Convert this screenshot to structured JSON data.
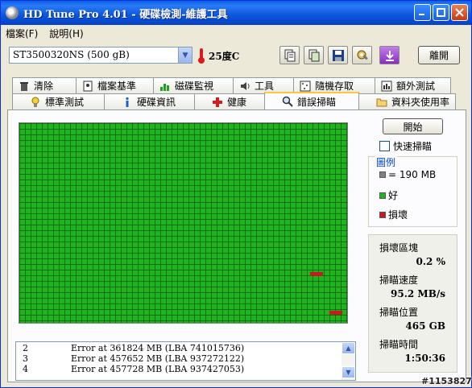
{
  "window": {
    "title": "HD Tune Pro 4.01 - 硬碟檢測-維護工具",
    "minimize_icon": "minimize-icon",
    "maximize_icon": "maximize-icon",
    "close_icon": "close-icon"
  },
  "menu": {
    "items": [
      {
        "label": "檔案(F)"
      },
      {
        "label": "說明(H)"
      }
    ]
  },
  "toolbar": {
    "drive": "ST3500320NS (500 gB)",
    "temperature": "25度C",
    "exit_label": "離開",
    "icons": [
      "copy-text-icon",
      "copy-screenshot-icon",
      "save-icon",
      "options-icon",
      "download-icon"
    ]
  },
  "tabs": {
    "row1": [
      {
        "label": "清除",
        "icon": "trash-icon"
      },
      {
        "label": "檔案基準",
        "icon": "file-benchmark-icon"
      },
      {
        "label": "磁碟監視",
        "icon": "disk-monitor-icon"
      },
      {
        "label": "工具",
        "icon": "speaker-icon"
      },
      {
        "label": "隨機存取",
        "icon": "random-access-icon"
      },
      {
        "label": "額外測試",
        "icon": "extra-tests-icon"
      }
    ],
    "row2": [
      {
        "label": "標準測試",
        "icon": "bulb-icon"
      },
      {
        "label": "硬碟資訊",
        "icon": "info-icon"
      },
      {
        "label": "健康",
        "icon": "health-cross-icon"
      },
      {
        "label": "錯誤掃瞄",
        "icon": "magnifier-icon",
        "active": true
      },
      {
        "label": "資料夾使用率",
        "icon": "folder-icon"
      }
    ]
  },
  "scan": {
    "start_label": "開始",
    "quick_scan_label": "快速掃瞄",
    "quick_scan_checked": false,
    "legend": {
      "title": "圖例",
      "block_size": "= 190 MB",
      "good": "好",
      "bad": "損壞"
    },
    "colors": {
      "good": "#1FB41F",
      "bad": "#C41C1C",
      "block": "#808080"
    },
    "stats": {
      "damaged_label": "損壞區塊",
      "damaged_value": "0.2 %",
      "speed_label": "掃瞄速度",
      "speed_value": "95.2 MB/s",
      "position_label": "掃瞄位置",
      "position_value": "465 GB",
      "time_label": "掃瞄時間",
      "time_value": "1:50:36"
    },
    "log": [
      {
        "num": "2",
        "text": "Error at 361824 MB (LBA 741015736)"
      },
      {
        "num": "3",
        "text": "Error at 457652 MB (LBA 937272122)"
      },
      {
        "num": "4",
        "text": "Error at 457728 MB (LBA 937427053)"
      }
    ]
  },
  "watermark": "#1153827"
}
